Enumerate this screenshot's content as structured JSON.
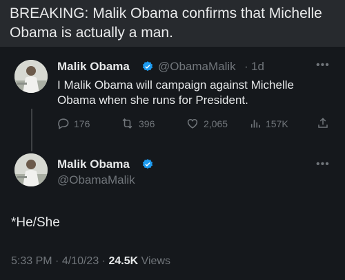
{
  "caption": "BREAKING: Malik Obama confirms that Michelle Obama is actually a man.",
  "colors": {
    "background": "#15181c",
    "caption_bg": "#272a2e",
    "verified": "#1d9bf0",
    "muted": "#71767b"
  },
  "tweet1": {
    "name": "Malik Obama",
    "handle": "@ObamaMalik",
    "separator": "·",
    "time": "1d",
    "text": "I Malik Obama will campaign against Michelle Obama when she runs for President.",
    "replies": "176",
    "retweets": "396",
    "likes": "2,065",
    "views": "157K",
    "icons": [
      "reply-icon",
      "retweet-icon",
      "like-icon",
      "views-icon",
      "share-icon",
      "more-icon",
      "verified-badge-icon"
    ]
  },
  "tweet2": {
    "name": "Malik Obama",
    "handle": "@ObamaMalik",
    "text": "*He/She",
    "time": "5:33 PM",
    "date": "4/10/23",
    "dot": "·",
    "views_count": "24.5K",
    "views_label": "Views"
  }
}
